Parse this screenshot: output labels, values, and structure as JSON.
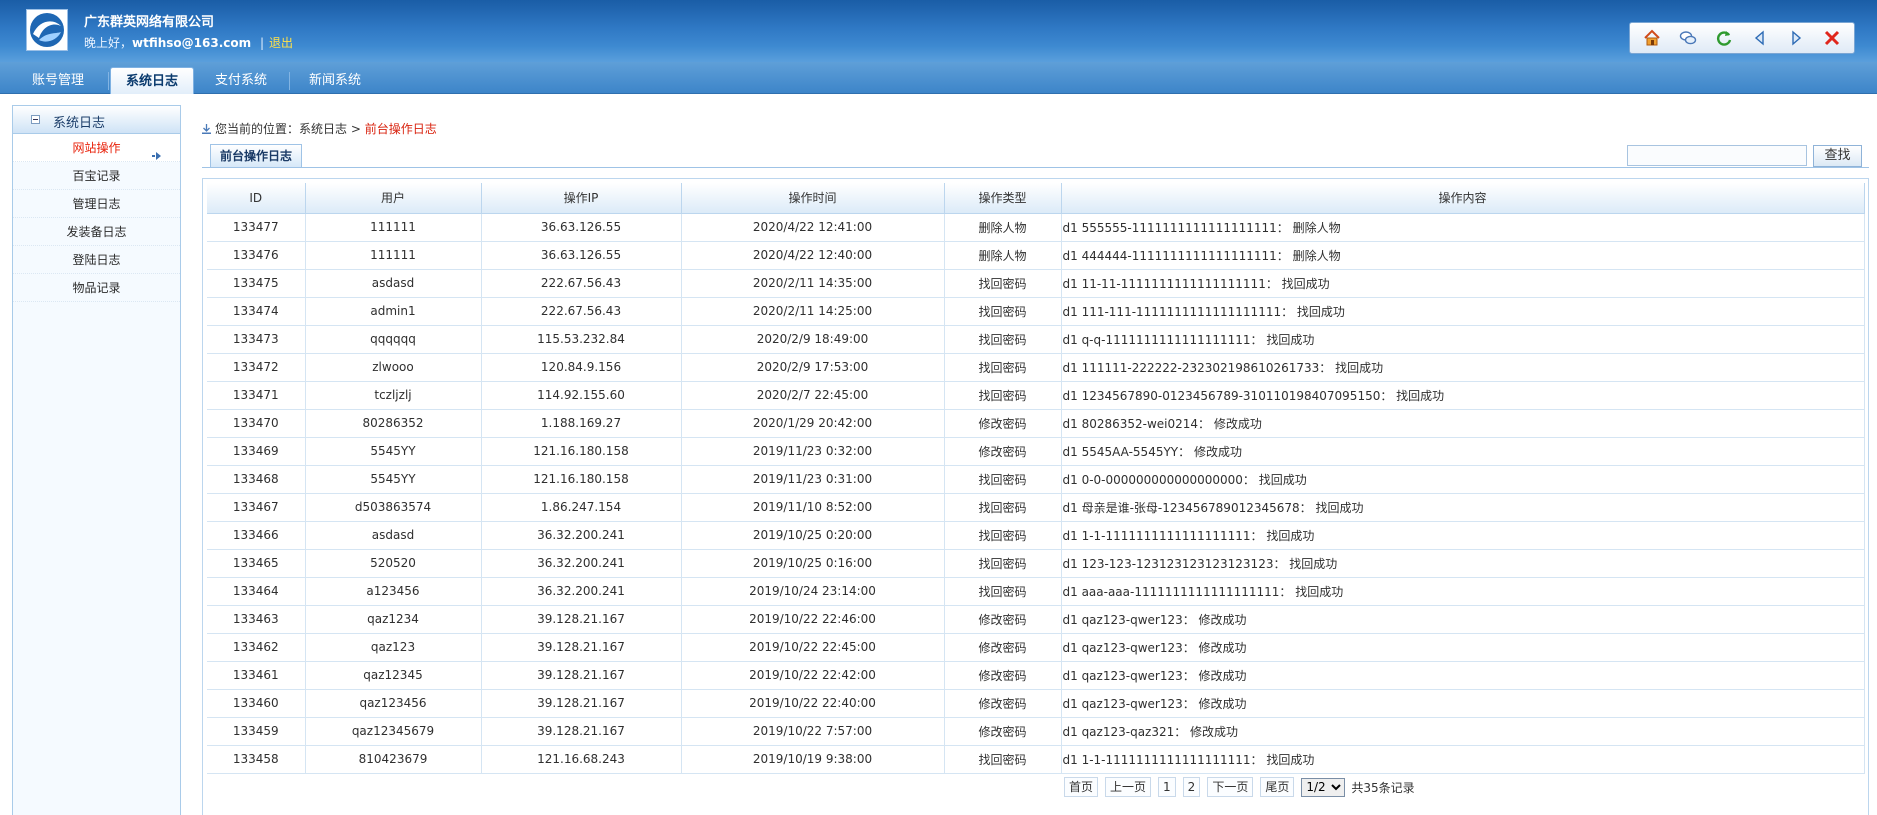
{
  "header": {
    "company": "广东群英网络有限公司",
    "greeting": "晚上好，",
    "email": "wtfihso@163.com",
    "separator": "|",
    "logout": "退出",
    "toolbar": [
      "home-icon",
      "chat-icon",
      "refresh-icon",
      "back-icon",
      "forward-icon",
      "close-icon"
    ]
  },
  "tabs": [
    {
      "label": "账号管理",
      "active": false
    },
    {
      "label": "系统日志",
      "active": true
    },
    {
      "label": "支付系统",
      "active": false
    },
    {
      "label": "新闻系统",
      "active": false
    }
  ],
  "sidebar": {
    "title": "系统日志",
    "items": [
      {
        "label": "网站操作",
        "active": true
      },
      {
        "label": "百宝记录",
        "active": false
      },
      {
        "label": "管理日志",
        "active": false
      },
      {
        "label": "发装备日志",
        "active": false
      },
      {
        "label": "登陆日志",
        "active": false
      },
      {
        "label": "物品记录",
        "active": false
      }
    ]
  },
  "breadcrumb": {
    "prefix": "您当前的位置：",
    "parent": "系统日志",
    "sep": " > ",
    "current": "前台操作日志"
  },
  "subtab": "前台操作日志",
  "search": {
    "placeholder": "",
    "button": "查找"
  },
  "table": {
    "headers": [
      "ID",
      "用户",
      "操作IP",
      "操作时间",
      "操作类型",
      "操作内容"
    ],
    "rows": [
      [
        "133477",
        "111111",
        "36.63.126.55",
        "2020/4/22 12:41:00",
        "删除人物",
        "d1 555555-1111111111111111111：  删除人物"
      ],
      [
        "133476",
        "111111",
        "36.63.126.55",
        "2020/4/22 12:40:00",
        "删除人物",
        "d1 444444-1111111111111111111：  删除人物"
      ],
      [
        "133475",
        "asdasd",
        "222.67.56.43",
        "2020/2/11 14:35:00",
        "找回密码",
        "d1 11-11-1111111111111111111：  找回成功"
      ],
      [
        "133474",
        "admin1",
        "222.67.56.43",
        "2020/2/11 14:25:00",
        "找回密码",
        "d1 111-111-1111111111111111111：  找回成功"
      ],
      [
        "133473",
        "qqqqqq",
        "115.53.232.84",
        "2020/2/9 18:49:00",
        "找回密码",
        "d1 q-q-1111111111111111111：  找回成功"
      ],
      [
        "133472",
        "zlwooo",
        "120.84.9.156",
        "2020/2/9 17:53:00",
        "找回密码",
        "d1 111111-222222-232302198610261733：  找回成功"
      ],
      [
        "133471",
        "tczljzlj",
        "114.92.155.60",
        "2020/2/7 22:45:00",
        "找回密码",
        "d1 1234567890-0123456789-310110198407095150：  找回成功"
      ],
      [
        "133470",
        "80286352",
        "1.188.169.27",
        "2020/1/29 20:42:00",
        "修改密码",
        "d1 80286352-wei0214：  修改成功"
      ],
      [
        "133469",
        "5545YY",
        "121.16.180.158",
        "2019/11/23 0:32:00",
        "修改密码",
        "d1 5545AA-5545YY：  修改成功"
      ],
      [
        "133468",
        "5545YY",
        "121.16.180.158",
        "2019/11/23 0:31:00",
        "找回密码",
        "d1 0-0-000000000000000000：  找回成功"
      ],
      [
        "133467",
        "d503863574",
        "1.86.247.154",
        "2019/11/10 8:52:00",
        "找回密码",
        "d1 母亲是谁-张母-123456789012345678：  找回成功"
      ],
      [
        "133466",
        "asdasd",
        "36.32.200.241",
        "2019/10/25 0:20:00",
        "找回密码",
        "d1 1-1-1111111111111111111：  找回成功"
      ],
      [
        "133465",
        "520520",
        "36.32.200.241",
        "2019/10/25 0:16:00",
        "找回密码",
        "d1 123-123-123123123123123123：  找回成功"
      ],
      [
        "133464",
        "a123456",
        "36.32.200.241",
        "2019/10/24 23:14:00",
        "找回密码",
        "d1 aaa-aaa-1111111111111111111：  找回成功"
      ],
      [
        "133463",
        "qaz1234",
        "39.128.21.167",
        "2019/10/22 22:46:00",
        "修改密码",
        "d1 qaz123-qwer123：  修改成功"
      ],
      [
        "133462",
        "qaz123",
        "39.128.21.167",
        "2019/10/22 22:45:00",
        "修改密码",
        "d1 qaz123-qwer123：  修改成功"
      ],
      [
        "133461",
        "qaz12345",
        "39.128.21.167",
        "2019/10/22 22:42:00",
        "修改密码",
        "d1 qaz123-qwer123：  修改成功"
      ],
      [
        "133460",
        "qaz123456",
        "39.128.21.167",
        "2019/10/22 22:40:00",
        "修改密码",
        "d1 qaz123-qwer123：  修改成功"
      ],
      [
        "133459",
        "qaz12345679",
        "39.128.21.167",
        "2019/10/22 7:57:00",
        "修改密码",
        "d1 qaz123-qaz321：  修改成功"
      ],
      [
        "133458",
        "810423679",
        "121.16.68.243",
        "2019/10/19 9:38:00",
        "找回密码",
        "d1 1-1-1111111111111111111：  找回成功"
      ]
    ]
  },
  "pager": {
    "first": "首页",
    "prev": "上一页",
    "pages": [
      "1",
      "2"
    ],
    "next": "下一页",
    "last": "尾页",
    "select_value": "1/2",
    "total": "共35条记录"
  },
  "colors": {
    "accent": "#3d85c9",
    "active_text": "#e8220b",
    "header_dark": "#1a5da6"
  }
}
